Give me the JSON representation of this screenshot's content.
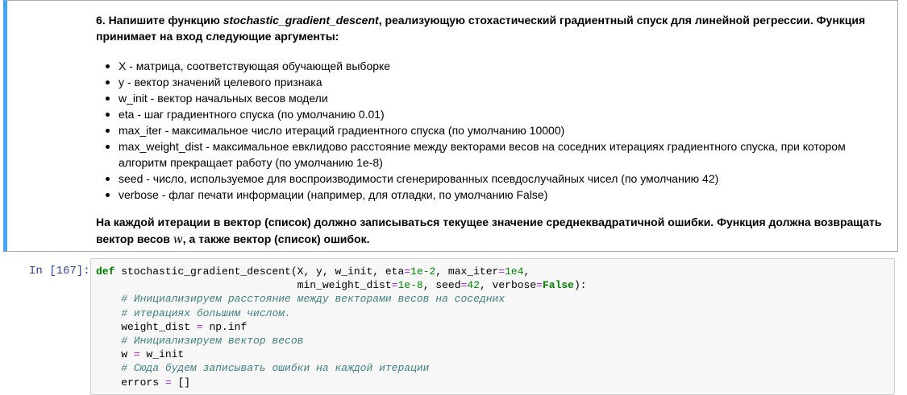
{
  "markdown_cell": {
    "heading_prefix": "6. Напишите функцию ",
    "heading_fn": "stochastic_gradient_descent",
    "heading_suffix": ", реализующую стохастический градиентный спуск для линейной регрессии. Функция принимает на вход следующие аргументы:",
    "bullets": [
      "X - матрица, соответствующая обучающей выборке",
      "y - вектор значений целевого признака",
      "w_init - вектор начальных весов модели",
      "eta - шаг градиентного спуска (по умолчанию 0.01)",
      "max_iter - максимальное число итераций градиентного спуска (по умолчанию 10000)",
      "max_weight_dist - максимальное евклидово расстояние между векторами весов на соседних итерациях градиентного спуска, при котором алгоритм прекращает работу (по умолчанию 1e-8)",
      "seed - число, используемое для воспроизводимости сгенерированных псевдослучайных чисел (по умолчанию 42)",
      "verbose - флаг печати информации (например, для отладки, по умолчанию False)"
    ],
    "footer_prefix": "На каждой итерации в вектор (список) должно записываться текущее значение среднеквадратичной ошибки. Функция должна возвращать вектор весов ",
    "footer_math": "w",
    "footer_suffix": ", а также вектор (список) ошибок."
  },
  "code_cell": {
    "prompt": "In [167]:",
    "lines": [
      {
        "t": "def stochastic_gradient_descent(X, y, w_init, eta=1e-2, max_iter=1e4,"
      },
      {
        "t": "                                min_weight_dist=1e-8, seed=42, verbose=False):"
      },
      {
        "t": "    # Инициализируем расстояние между векторами весов на соседних"
      },
      {
        "t": "    # итерациях большим числом."
      },
      {
        "t": "    weight_dist = np.inf"
      },
      {
        "t": "    # Инициализируем вектор весов"
      },
      {
        "t": "    w = w_init"
      },
      {
        "t": "    # Сюда будем записывать ошибки на каждой итерации"
      },
      {
        "t": "    errors = []"
      }
    ]
  },
  "colors": {
    "selected_cell_border": "#42a5f5",
    "prompt": "#303f9f",
    "keyword": "#008000",
    "comment": "#408080",
    "operator": "#aa22ff",
    "code_bg": "#f7f7f7"
  }
}
